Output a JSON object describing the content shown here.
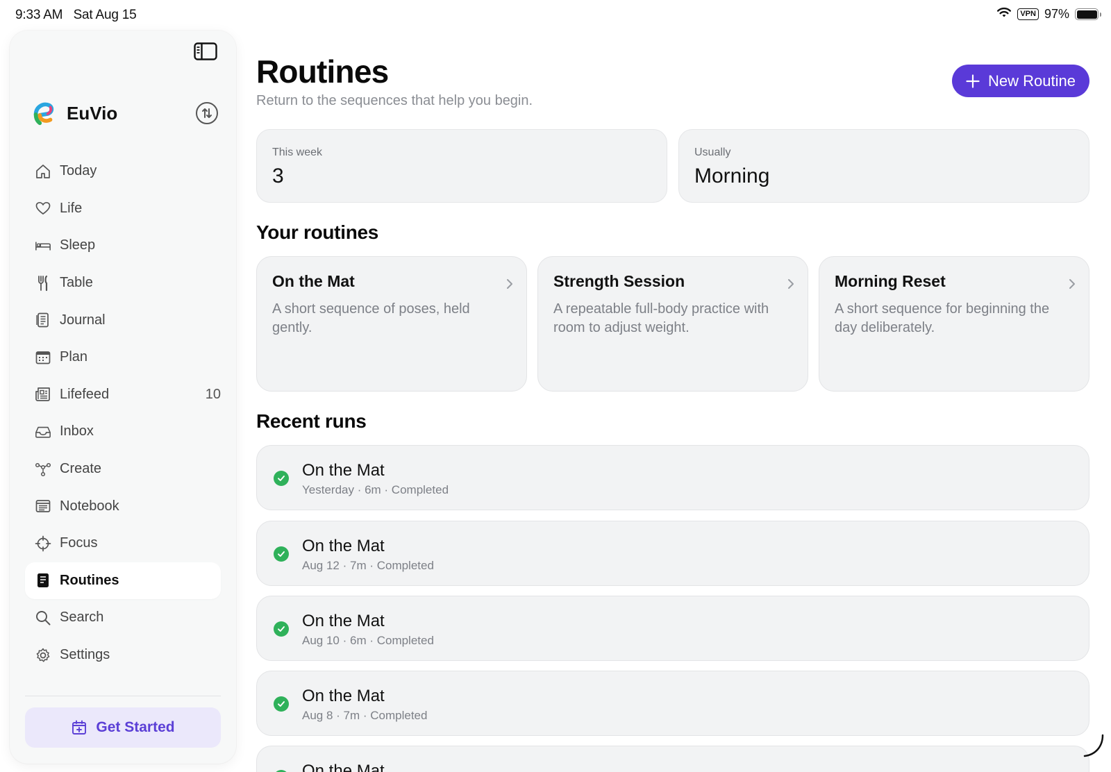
{
  "status_bar": {
    "time": "9:33 AM",
    "date": "Sat Aug 15",
    "vpn": "VPN",
    "battery": "97%"
  },
  "sidebar": {
    "brand": "EuVio",
    "items": [
      {
        "label": "Today",
        "icon": "home-icon"
      },
      {
        "label": "Life",
        "icon": "heart-icon"
      },
      {
        "label": "Sleep",
        "icon": "bed-icon"
      },
      {
        "label": "Table",
        "icon": "utensils-icon"
      },
      {
        "label": "Journal",
        "icon": "journal-icon"
      },
      {
        "label": "Plan",
        "icon": "calendar-icon"
      },
      {
        "label": "Lifefeed",
        "icon": "newspaper-icon",
        "count": "10"
      },
      {
        "label": "Inbox",
        "icon": "inbox-icon"
      },
      {
        "label": "Create",
        "icon": "nodes-icon"
      },
      {
        "label": "Notebook",
        "icon": "notebook-icon"
      },
      {
        "label": "Focus",
        "icon": "crosshair-icon"
      },
      {
        "label": "Routines",
        "icon": "routines-icon",
        "active": true
      },
      {
        "label": "Search",
        "icon": "search-icon"
      },
      {
        "label": "Settings",
        "icon": "gear-icon"
      }
    ],
    "get_started": "Get Started"
  },
  "header": {
    "title": "Routines",
    "subtitle": "Return to the sequences that help you begin.",
    "new_button": "New Routine"
  },
  "stats": [
    {
      "label": "This week",
      "value": "3"
    },
    {
      "label": "Usually",
      "value": "Morning"
    }
  ],
  "sections": {
    "your_routines": "Your routines",
    "recent_runs": "Recent runs"
  },
  "routines": [
    {
      "title": "On the Mat",
      "description": "A short sequence of poses, held gently."
    },
    {
      "title": "Strength Session",
      "description": "A repeatable full-body practice with room to adjust weight."
    },
    {
      "title": "Morning Reset",
      "description": "A short sequence for beginning the day deliberately."
    }
  ],
  "runs": [
    {
      "title": "On the Mat",
      "meta": "Yesterday · 6m · Completed"
    },
    {
      "title": "On the Mat",
      "meta": "Aug 12 · 7m · Completed"
    },
    {
      "title": "On the Mat",
      "meta": "Aug 10 · 6m · Completed"
    },
    {
      "title": "On the Mat",
      "meta": "Aug 8 · 7m · Completed"
    },
    {
      "title": "On the Mat",
      "meta": ""
    }
  ],
  "colors": {
    "accent": "#5a3ad8",
    "success": "#2fb15a",
    "get_started_bg": "#ebe8fb"
  }
}
